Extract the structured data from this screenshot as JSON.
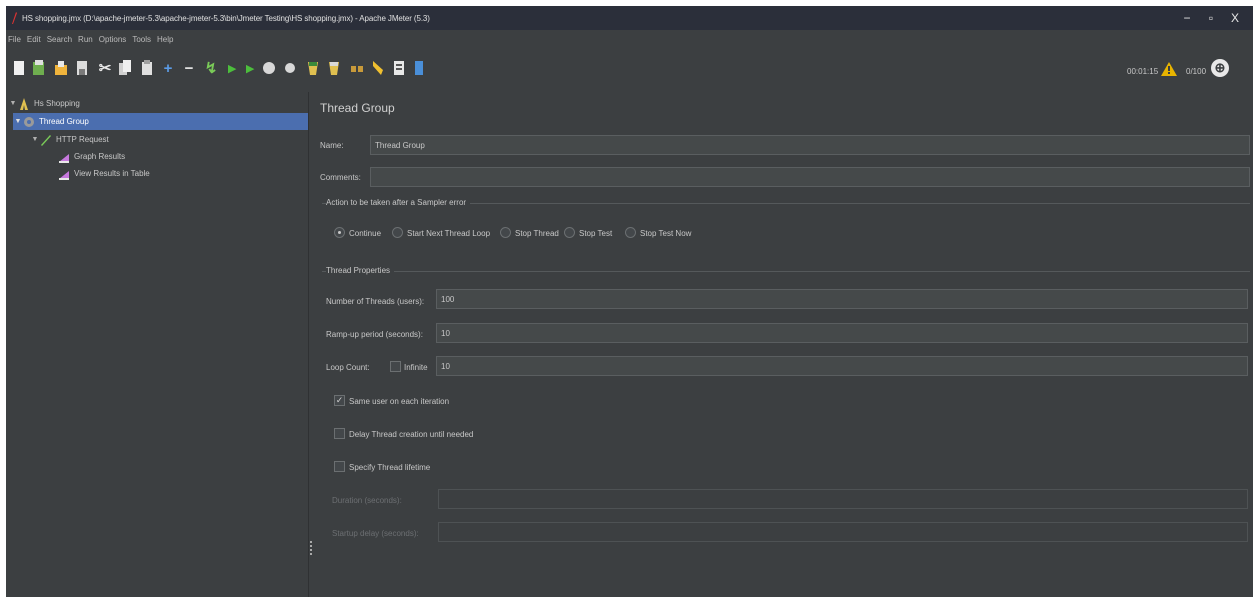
{
  "window": {
    "title": "HS shopping.jmx (D:\\apache-jmeter-5.3\\apache-jmeter-5.3\\bin\\Jmeter Testing\\HS shopping.jmx) - Apache JMeter (5.3)",
    "minimize": "−",
    "maximize": "▫",
    "close": "X"
  },
  "menu": [
    "File",
    "Edit",
    "Search",
    "Run",
    "Options",
    "Tools",
    "Help"
  ],
  "toolbar": {
    "icons": [
      "new-icon",
      "templates-icon",
      "open-icon",
      "save-icon",
      "cut-icon",
      "copy-icon",
      "paste-icon",
      "expand-icon",
      "collapse-icon",
      "toggle-icon",
      "start-icon",
      "start-no-pauses-icon",
      "stop-icon",
      "shutdown-icon",
      "clear-icon",
      "clear-all-icon",
      "search-icon",
      "reset-search-icon",
      "function-helper-icon",
      "help-icon"
    ],
    "elapsed_time": "00:01:15",
    "warn_count": "0",
    "threads": "0/100"
  },
  "tree": {
    "root": "Hs Shopping",
    "thread_group": "Thread Group",
    "http_request": "HTTP Request",
    "graph_results": "Graph Results",
    "view_results_table": "View Results in Table"
  },
  "panel": {
    "title": "Thread Group",
    "name_label": "Name:",
    "name_value": "Thread Group",
    "comments_label": "Comments:",
    "comments_value": "",
    "sampler_error_title": "Action to be taken after a Sampler error",
    "sampler_error_options": [
      "Continue",
      "Start Next Thread Loop",
      "Stop Thread",
      "Stop Test",
      "Stop Test Now"
    ],
    "thread_props_title": "Thread Properties",
    "num_threads_label": "Number of Threads (users):",
    "num_threads_value": "100",
    "rampup_label": "Ramp-up period (seconds):",
    "rampup_value": "10",
    "loop_count_label": "Loop Count:",
    "infinite_label": "Infinite",
    "loop_count_value": "10",
    "same_user_label": "Same user on each iteration",
    "same_user_checked": true,
    "delay_label": "Delay Thread creation until needed",
    "specify_lifetime_label": "Specify Thread lifetime",
    "duration_label": "Duration (seconds):",
    "startup_delay_label": "Startup delay (seconds):"
  },
  "colors": {
    "background": "#3c3f41",
    "selection": "#4b6eaf",
    "titlebar": "#2b2f3a",
    "field": "#45494a",
    "warning": "#e8b400"
  }
}
